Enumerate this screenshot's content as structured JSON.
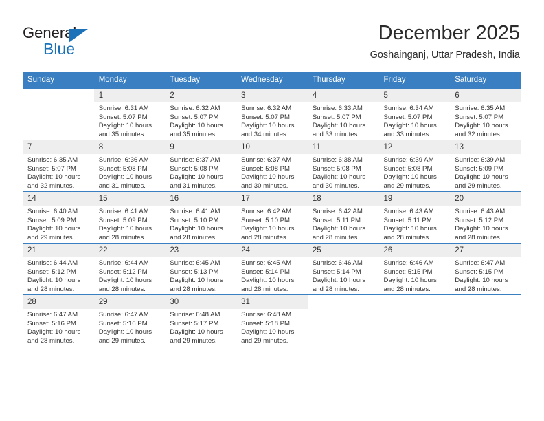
{
  "brand": {
    "word_one": "General",
    "word_two": "Blue",
    "accent_color": "#1b72b8"
  },
  "header": {
    "title": "December 2025",
    "location": "Goshainganj, Uttar Pradesh, India"
  },
  "theme": {
    "header_row_background": "#3a7fc1",
    "day_number_background": "#eeeeee",
    "text_color": "#333333"
  },
  "columns": [
    "Sunday",
    "Monday",
    "Tuesday",
    "Wednesday",
    "Thursday",
    "Friday",
    "Saturday"
  ],
  "labels": {
    "sunrise_prefix": "Sunrise:",
    "sunset_prefix": "Sunset:",
    "daylight_prefix": "Daylight:"
  },
  "weeks": [
    [
      {
        "day": "",
        "blank": true
      },
      {
        "day": "1",
        "sunrise": "Sunrise: 6:31 AM",
        "sunset": "Sunset: 5:07 PM",
        "daylight_line1": "Daylight: 10 hours",
        "daylight_line2": "and 35 minutes."
      },
      {
        "day": "2",
        "sunrise": "Sunrise: 6:32 AM",
        "sunset": "Sunset: 5:07 PM",
        "daylight_line1": "Daylight: 10 hours",
        "daylight_line2": "and 35 minutes."
      },
      {
        "day": "3",
        "sunrise": "Sunrise: 6:32 AM",
        "sunset": "Sunset: 5:07 PM",
        "daylight_line1": "Daylight: 10 hours",
        "daylight_line2": "and 34 minutes."
      },
      {
        "day": "4",
        "sunrise": "Sunrise: 6:33 AM",
        "sunset": "Sunset: 5:07 PM",
        "daylight_line1": "Daylight: 10 hours",
        "daylight_line2": "and 33 minutes."
      },
      {
        "day": "5",
        "sunrise": "Sunrise: 6:34 AM",
        "sunset": "Sunset: 5:07 PM",
        "daylight_line1": "Daylight: 10 hours",
        "daylight_line2": "and 33 minutes."
      },
      {
        "day": "6",
        "sunrise": "Sunrise: 6:35 AM",
        "sunset": "Sunset: 5:07 PM",
        "daylight_line1": "Daylight: 10 hours",
        "daylight_line2": "and 32 minutes."
      }
    ],
    [
      {
        "day": "7",
        "sunrise": "Sunrise: 6:35 AM",
        "sunset": "Sunset: 5:07 PM",
        "daylight_line1": "Daylight: 10 hours",
        "daylight_line2": "and 32 minutes."
      },
      {
        "day": "8",
        "sunrise": "Sunrise: 6:36 AM",
        "sunset": "Sunset: 5:08 PM",
        "daylight_line1": "Daylight: 10 hours",
        "daylight_line2": "and 31 minutes."
      },
      {
        "day": "9",
        "sunrise": "Sunrise: 6:37 AM",
        "sunset": "Sunset: 5:08 PM",
        "daylight_line1": "Daylight: 10 hours",
        "daylight_line2": "and 31 minutes."
      },
      {
        "day": "10",
        "sunrise": "Sunrise: 6:37 AM",
        "sunset": "Sunset: 5:08 PM",
        "daylight_line1": "Daylight: 10 hours",
        "daylight_line2": "and 30 minutes."
      },
      {
        "day": "11",
        "sunrise": "Sunrise: 6:38 AM",
        "sunset": "Sunset: 5:08 PM",
        "daylight_line1": "Daylight: 10 hours",
        "daylight_line2": "and 30 minutes."
      },
      {
        "day": "12",
        "sunrise": "Sunrise: 6:39 AM",
        "sunset": "Sunset: 5:08 PM",
        "daylight_line1": "Daylight: 10 hours",
        "daylight_line2": "and 29 minutes."
      },
      {
        "day": "13",
        "sunrise": "Sunrise: 6:39 AM",
        "sunset": "Sunset: 5:09 PM",
        "daylight_line1": "Daylight: 10 hours",
        "daylight_line2": "and 29 minutes."
      }
    ],
    [
      {
        "day": "14",
        "sunrise": "Sunrise: 6:40 AM",
        "sunset": "Sunset: 5:09 PM",
        "daylight_line1": "Daylight: 10 hours",
        "daylight_line2": "and 29 minutes."
      },
      {
        "day": "15",
        "sunrise": "Sunrise: 6:41 AM",
        "sunset": "Sunset: 5:09 PM",
        "daylight_line1": "Daylight: 10 hours",
        "daylight_line2": "and 28 minutes."
      },
      {
        "day": "16",
        "sunrise": "Sunrise: 6:41 AM",
        "sunset": "Sunset: 5:10 PM",
        "daylight_line1": "Daylight: 10 hours",
        "daylight_line2": "and 28 minutes."
      },
      {
        "day": "17",
        "sunrise": "Sunrise: 6:42 AM",
        "sunset": "Sunset: 5:10 PM",
        "daylight_line1": "Daylight: 10 hours",
        "daylight_line2": "and 28 minutes."
      },
      {
        "day": "18",
        "sunrise": "Sunrise: 6:42 AM",
        "sunset": "Sunset: 5:11 PM",
        "daylight_line1": "Daylight: 10 hours",
        "daylight_line2": "and 28 minutes."
      },
      {
        "day": "19",
        "sunrise": "Sunrise: 6:43 AM",
        "sunset": "Sunset: 5:11 PM",
        "daylight_line1": "Daylight: 10 hours",
        "daylight_line2": "and 28 minutes."
      },
      {
        "day": "20",
        "sunrise": "Sunrise: 6:43 AM",
        "sunset": "Sunset: 5:12 PM",
        "daylight_line1": "Daylight: 10 hours",
        "daylight_line2": "and 28 minutes."
      }
    ],
    [
      {
        "day": "21",
        "sunrise": "Sunrise: 6:44 AM",
        "sunset": "Sunset: 5:12 PM",
        "daylight_line1": "Daylight: 10 hours",
        "daylight_line2": "and 28 minutes."
      },
      {
        "day": "22",
        "sunrise": "Sunrise: 6:44 AM",
        "sunset": "Sunset: 5:12 PM",
        "daylight_line1": "Daylight: 10 hours",
        "daylight_line2": "and 28 minutes."
      },
      {
        "day": "23",
        "sunrise": "Sunrise: 6:45 AM",
        "sunset": "Sunset: 5:13 PM",
        "daylight_line1": "Daylight: 10 hours",
        "daylight_line2": "and 28 minutes."
      },
      {
        "day": "24",
        "sunrise": "Sunrise: 6:45 AM",
        "sunset": "Sunset: 5:14 PM",
        "daylight_line1": "Daylight: 10 hours",
        "daylight_line2": "and 28 minutes."
      },
      {
        "day": "25",
        "sunrise": "Sunrise: 6:46 AM",
        "sunset": "Sunset: 5:14 PM",
        "daylight_line1": "Daylight: 10 hours",
        "daylight_line2": "and 28 minutes."
      },
      {
        "day": "26",
        "sunrise": "Sunrise: 6:46 AM",
        "sunset": "Sunset: 5:15 PM",
        "daylight_line1": "Daylight: 10 hours",
        "daylight_line2": "and 28 minutes."
      },
      {
        "day": "27",
        "sunrise": "Sunrise: 6:47 AM",
        "sunset": "Sunset: 5:15 PM",
        "daylight_line1": "Daylight: 10 hours",
        "daylight_line2": "and 28 minutes."
      }
    ],
    [
      {
        "day": "28",
        "sunrise": "Sunrise: 6:47 AM",
        "sunset": "Sunset: 5:16 PM",
        "daylight_line1": "Daylight: 10 hours",
        "daylight_line2": "and 28 minutes."
      },
      {
        "day": "29",
        "sunrise": "Sunrise: 6:47 AM",
        "sunset": "Sunset: 5:16 PM",
        "daylight_line1": "Daylight: 10 hours",
        "daylight_line2": "and 29 minutes."
      },
      {
        "day": "30",
        "sunrise": "Sunrise: 6:48 AM",
        "sunset": "Sunset: 5:17 PM",
        "daylight_line1": "Daylight: 10 hours",
        "daylight_line2": "and 29 minutes."
      },
      {
        "day": "31",
        "sunrise": "Sunrise: 6:48 AM",
        "sunset": "Sunset: 5:18 PM",
        "daylight_line1": "Daylight: 10 hours",
        "daylight_line2": "and 29 minutes."
      },
      {
        "day": "",
        "blank": true
      },
      {
        "day": "",
        "blank": true
      },
      {
        "day": "",
        "blank": true
      }
    ]
  ]
}
